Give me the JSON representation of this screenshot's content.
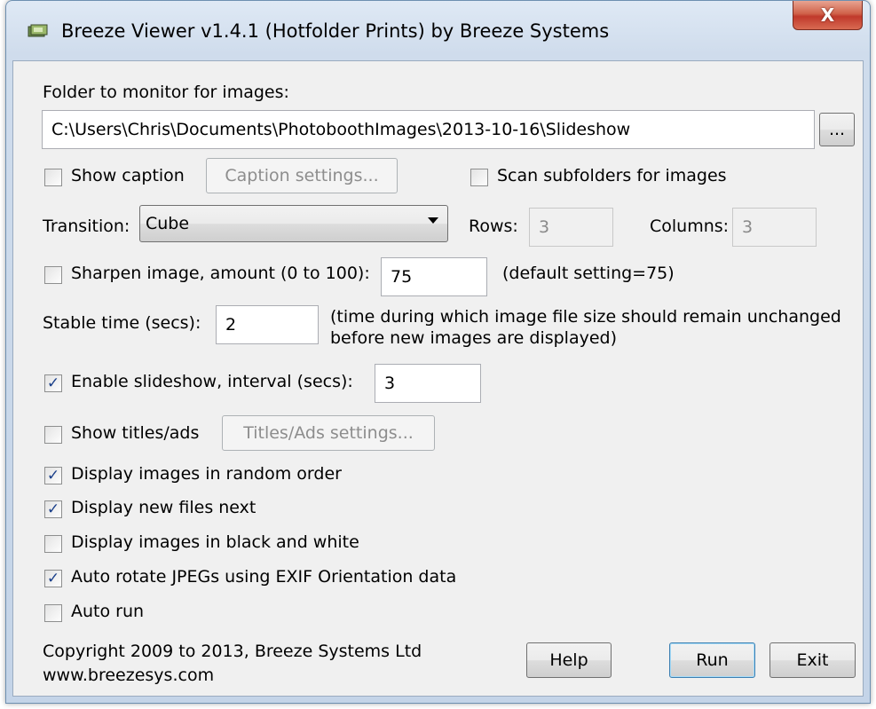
{
  "window": {
    "title": "Breeze Viewer v1.4.1 (Hotfolder Prints) by Breeze Systems",
    "close_glyph": "X"
  },
  "folder": {
    "label": "Folder to monitor for images:",
    "value": "C:\\Users\\Chris\\Documents\\PhotoboothImages\\2013-10-16\\Slideshow",
    "browse_label": "..."
  },
  "caption": {
    "label": "Show caption",
    "checked": false,
    "settings_label": "Caption settings..."
  },
  "scan_subfolders": {
    "label": "Scan subfolders for images",
    "checked": false
  },
  "transition": {
    "label": "Transition:",
    "value": "Cube",
    "rows_label": "Rows:",
    "rows_value": "3",
    "columns_label": "Columns:",
    "columns_value": "3"
  },
  "sharpen": {
    "label": "Sharpen image, amount (0 to 100):",
    "checked": false,
    "value": "75",
    "hint": "(default setting=75)"
  },
  "stable_time": {
    "label": "Stable time (secs):",
    "value": "2",
    "hint_line1": "(time during which image file size should remain unchanged",
    "hint_line2": "before new images are displayed)"
  },
  "slideshow": {
    "label": "Enable slideshow, interval (secs):",
    "checked": true,
    "value": "3"
  },
  "titles": {
    "label": "Show titles/ads",
    "checked": false,
    "settings_label": "Titles/Ads settings..."
  },
  "options": [
    {
      "label": "Display images in random order",
      "checked": true
    },
    {
      "label": "Display new files next",
      "checked": true
    },
    {
      "label": "Display images in black and white",
      "checked": false
    },
    {
      "label": "Auto rotate JPEGs using EXIF Orientation data",
      "checked": true
    },
    {
      "label": "Auto run",
      "checked": false
    }
  ],
  "footer": {
    "copyright": "Copyright 2009 to 2013, Breeze Systems Ltd",
    "website": "www.breezesys.com",
    "help_label": "Help",
    "run_label": "Run",
    "exit_label": "Exit"
  },
  "check_glyph": "✓"
}
